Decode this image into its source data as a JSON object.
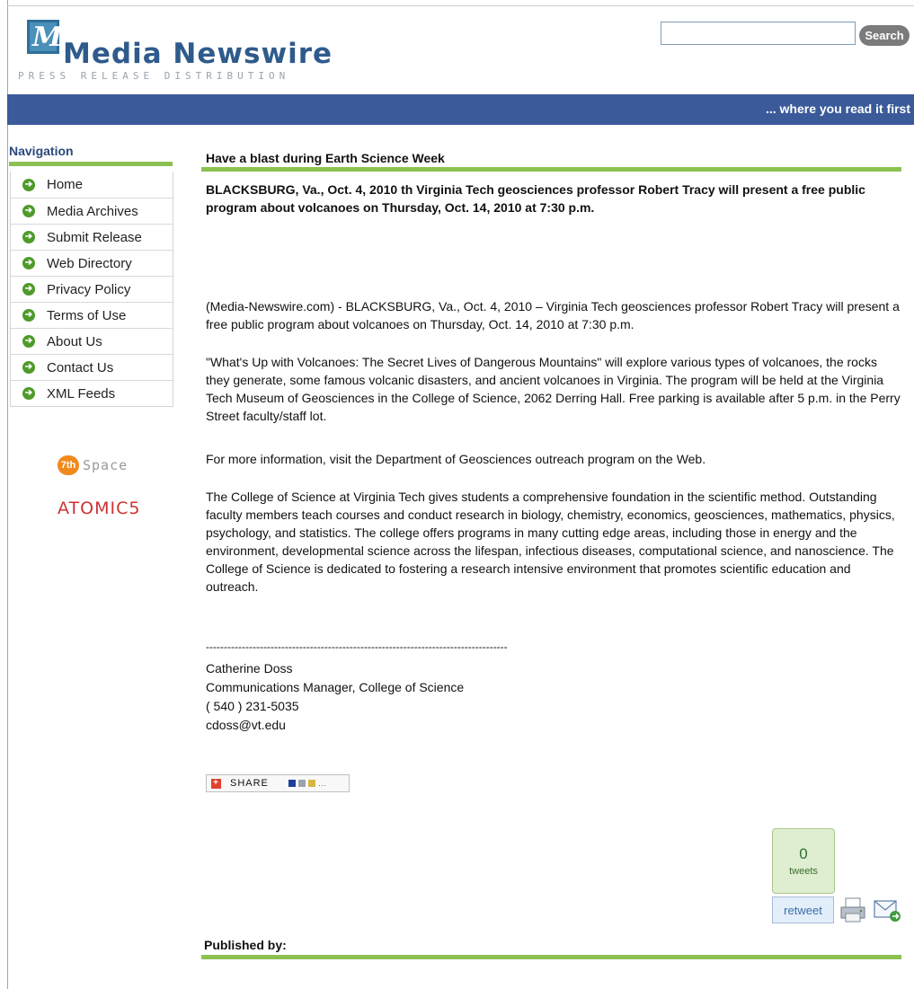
{
  "header": {
    "logo_letter": "M",
    "logo_name": "Media Newswire",
    "logo_subtitle": "PRESS RELEASE DISTRIBUTION",
    "search_button": "Search",
    "search_value": "",
    "tagline": "... where you read it first"
  },
  "nav": {
    "title": "Navigation",
    "items": [
      {
        "label": "Home"
      },
      {
        "label": "Media Archives"
      },
      {
        "label": "Submit Release"
      },
      {
        "label": "Web Directory"
      },
      {
        "label": "Privacy Policy"
      },
      {
        "label": "Terms of Use"
      },
      {
        "label": "About Us"
      },
      {
        "label": "Contact Us"
      },
      {
        "label": "XML Feeds"
      }
    ],
    "partner_7th_badge": "7th",
    "partner_7th_text": "Space",
    "partner_atomic": "ATOMIC5"
  },
  "article": {
    "title": "Have a blast during Earth Science Week",
    "summary": "BLACKSBURG, Va., Oct. 4, 2010 th Virginia Tech geosciences professor Robert Tracy will present a free public program about volcanoes on Thursday, Oct. 14, 2010 at 7:30 p.m.",
    "paragraphs": [
      "(Media-Newswire.com) - BLACKSBURG, Va., Oct. 4, 2010 – Virginia Tech geosciences professor Robert Tracy will present a free public program about volcanoes on Thursday, Oct. 14, 2010 at 7:30 p.m.",
      "\"What's Up with Volcanoes: The Secret Lives of Dangerous Mountains\" will explore various types of volcanoes, the rocks they generate, some famous volcanic disasters, and ancient volcanoes in Virginia. The program will be held at the Virginia Tech Museum of Geosciences in the College of Science, 2062 Derring Hall. Free parking is available after 5 p.m. in the Perry Street faculty/staff lot.",
      "For more information, visit the Department of Geosciences outreach program on the Web.",
      "The College of Science at Virginia Tech gives students a comprehensive foundation in the scientific method. Outstanding faculty members teach courses and conduct research in biology, chemistry, economics, geosciences, mathematics, physics, psychology, and statistics. The college offers programs in many cutting edge areas, including those in energy and the environment, developmental science across the lifespan, infectious diseases, computational science, and nanoscience. The College of Science is dedicated to fostering a research intensive environment that promotes scientific education and outreach."
    ],
    "divider": "------------------------------------------------------------------------------------",
    "contact": {
      "name": "Catherine Doss",
      "role": "Communications Manager, College of Science",
      "phone": "( 540 ) 231-5035",
      "email": "cdoss@vt.edu"
    },
    "share_label": "SHARE",
    "tweet_count": "0",
    "tweet_label": "tweets",
    "retweet_label": "retweet",
    "published_by": "Published by:"
  },
  "colors": {
    "banner": "#3b5a9a",
    "accent_green": "#8cc151",
    "nav_title": "#2a4a7a"
  }
}
